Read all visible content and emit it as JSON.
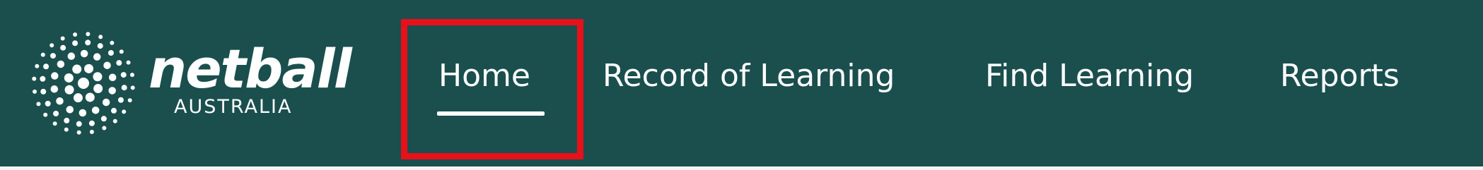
{
  "logo": {
    "word": "netball",
    "sub": "AUSTRALIA",
    "icon": "netball-starburst-logo"
  },
  "nav": {
    "items": [
      {
        "label": "Home",
        "active": true
      },
      {
        "label": "Record of Learning",
        "active": false
      },
      {
        "label": "Find Learning",
        "active": false
      },
      {
        "label": "Reports",
        "active": false
      }
    ]
  },
  "colors": {
    "navbar_bg": "#1a4f4e",
    "text": "#ffffff",
    "highlight": "#e8101a"
  }
}
